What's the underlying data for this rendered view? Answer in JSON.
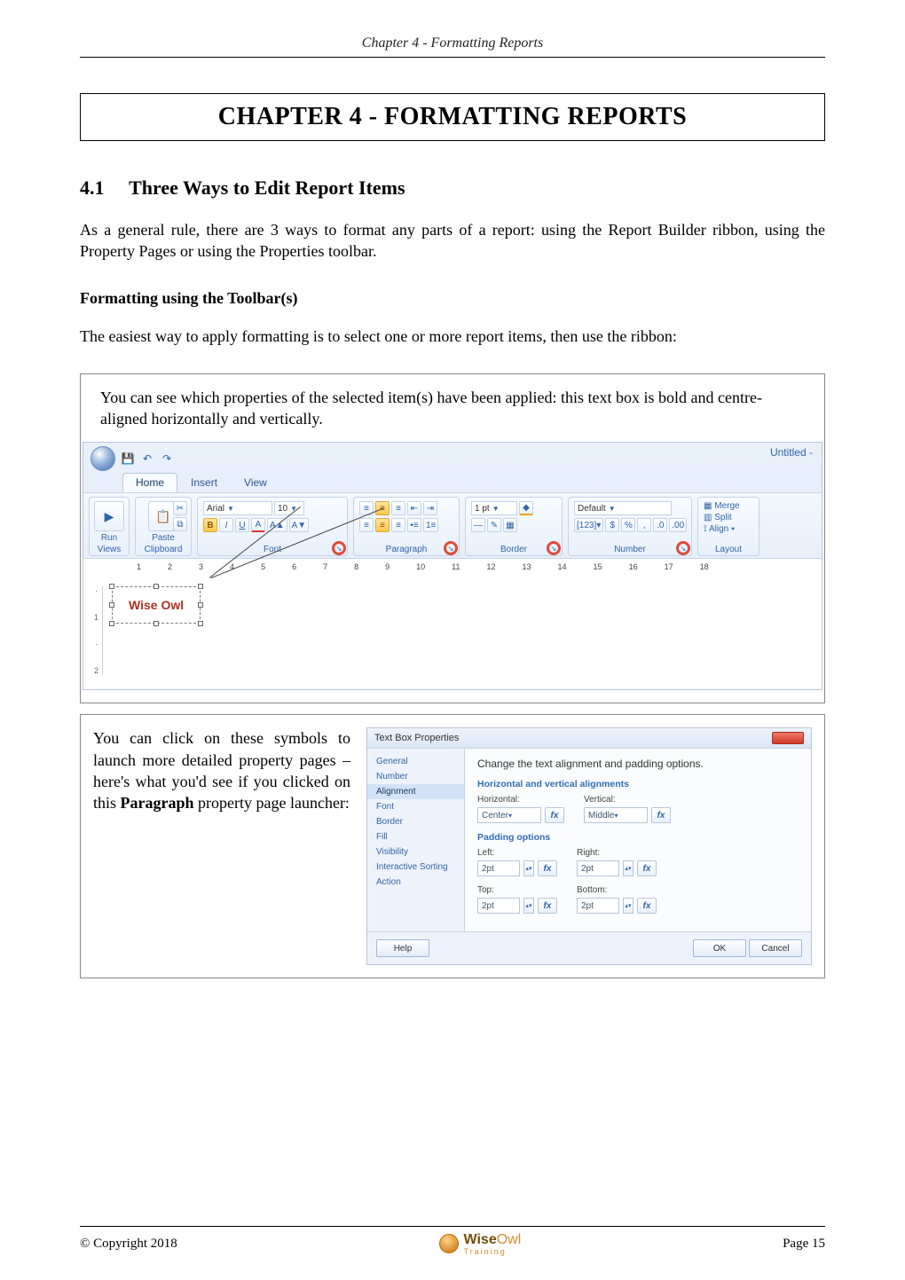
{
  "meta": {
    "running_head": "Chapter 4 - Formatting Reports",
    "chapter_title": "CHAPTER 4 - FORMATTING REPORTS",
    "copyright": "© Copyright 2018",
    "page_label": "Page 15",
    "logo_text_a": "Wise",
    "logo_text_b": "Owl",
    "logo_sub": "Training"
  },
  "section": {
    "number": "4.1",
    "title": "Three Ways to Edit Report Items",
    "intro": "As a general rule, there are 3 ways to format any parts of a report: using the Report Builder ribbon, using the Property Pages or using the Properties toolbar."
  },
  "sub1": {
    "heading": "Formatting using the Toolbar(s)",
    "lead": "The easiest way to apply formatting is to select one or more report items, then use the ribbon:"
  },
  "fig1": {
    "caption": "You can see which properties of the selected item(s) have been applied: this text box is bold and centre-aligned horizontally and vertically.",
    "window_title": "Untitled -",
    "tabs": [
      "Home",
      "Insert",
      "View"
    ],
    "groups": {
      "views": "Views",
      "clipboard": "Clipboard",
      "font": "Font",
      "paragraph": "Paragraph",
      "border": "Border",
      "number": "Number",
      "layout": "Layout"
    },
    "buttons": {
      "run": "Run",
      "paste": "Paste",
      "merge": "Merge",
      "split": "Split",
      "align": "Align"
    },
    "font": {
      "name": "Arial",
      "size": "10"
    },
    "border": {
      "width": "1 pt"
    },
    "number": {
      "format": "Default",
      "currency": "$",
      "percent": "%"
    },
    "ruler": [
      "1",
      "2",
      "3",
      "4",
      "5",
      "6",
      "7",
      "8",
      "9",
      "10",
      "11",
      "12",
      "13",
      "14",
      "15",
      "16",
      "17",
      "18"
    ],
    "sample_text": "Wise Owl"
  },
  "fig2": {
    "left_text_1": "You can click on these symbols to launch more detailed property pages – here's what you'd see if you clicked on this ",
    "left_text_bold": "Paragraph",
    "left_text_2": " property page launcher:",
    "dlg_title": "Text Box Properties",
    "nav": [
      "General",
      "Number",
      "Alignment",
      "Font",
      "Border",
      "Fill",
      "Visibility",
      "Interactive Sorting",
      "Action"
    ],
    "nav_selected": "Alignment",
    "main_heading": "Change the text alignment and padding options.",
    "sec1": "Horizontal and vertical alignments",
    "halign_label": "Horizontal:",
    "halign_value": "Center",
    "valign_label": "Vertical:",
    "valign_value": "Middle",
    "sec2": "Padding options",
    "pad": {
      "left_l": "Left:",
      "left_v": "2pt",
      "right_l": "Right:",
      "right_v": "2pt",
      "top_l": "Top:",
      "top_v": "2pt",
      "bottom_l": "Bottom:",
      "bottom_v": "2pt"
    },
    "btn_help": "Help",
    "btn_ok": "OK",
    "btn_cancel": "Cancel"
  }
}
